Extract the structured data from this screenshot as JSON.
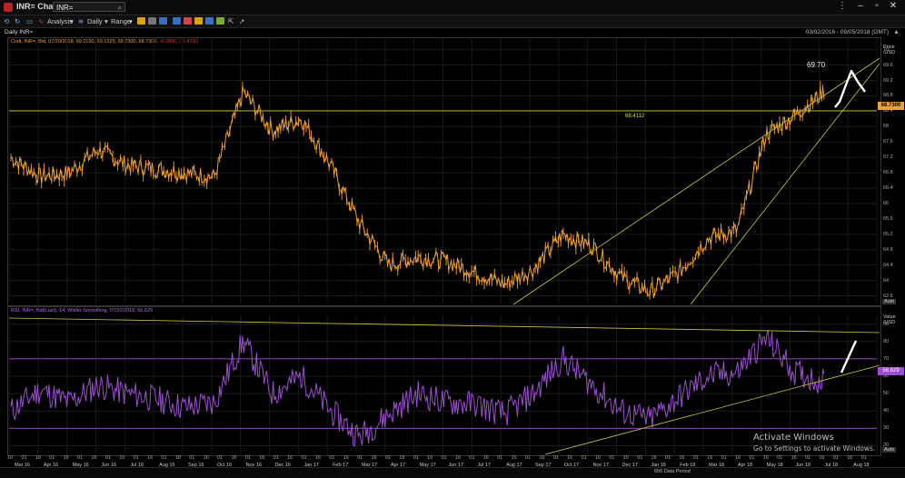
{
  "window": {
    "title": "INR= Chart",
    "symbol": "INR=",
    "minimize": "–",
    "maximize": "▫",
    "close": "✕",
    "more": "⋮"
  },
  "toolbar": {
    "analysis": "Analysis",
    "daily": "Daily",
    "range": "Range"
  },
  "header": {
    "title": "Daily INR=",
    "date_range": "03/02/2016 - 09/05/2018 (GMT)"
  },
  "price_panel": {
    "legend_main": "Cndl, INR=, Bid, 07/20/2018, 69.0150, 69.1225, 68.7300, 68.7300,",
    "legend_change": "-0.2800, (-0.41%)",
    "axis_title": "Price /USD",
    "ticks": [
      "70",
      "69.6",
      "69.2",
      "68.8",
      "68.4",
      "68",
      "67.6",
      "67.2",
      "66.8",
      "66.4",
      "66",
      "65.6",
      "65.2",
      "64.8",
      "64.4",
      "64",
      "63.6"
    ],
    "last_price": "68.7300",
    "hline_label": "68.4112",
    "annotation": "69.70",
    "auto": "Auto"
  },
  "rsi_panel": {
    "legend": "RSI, INR=, Bid(Last), 14, Wilder Smoothing, 07/20/2018, 56.629",
    "axis_title": "Value /USD",
    "ticks": [
      "90",
      "80",
      "70",
      "60",
      "50",
      "40",
      "30",
      "20"
    ],
    "last_value": "56.629",
    "auto": "Auto"
  },
  "xaxis": {
    "days": [
      "16",
      "01",
      "18",
      "01",
      "16",
      "01",
      "16",
      "01",
      "16",
      "01",
      "16",
      "01",
      "18",
      "01",
      "16",
      "01",
      "16",
      "01",
      "16",
      "01",
      "16",
      "01",
      "16",
      "01",
      "16",
      "01",
      "16",
      "01",
      "18",
      "01",
      "16",
      "01",
      "16",
      "01",
      "16",
      "01",
      "16",
      "01",
      "16",
      "01",
      "16",
      "01",
      "16",
      "01",
      "16",
      "01",
      "16",
      "01",
      "16",
      "01",
      "16",
      "01",
      "16",
      "01",
      "16",
      "01",
      "16",
      "01",
      "16",
      "01",
      "16",
      "01"
    ],
    "months": [
      "Mar 16",
      "Apr 16",
      "May 16",
      "Jun 16",
      "Jul 16",
      "Aug 16",
      "Sep 16",
      "Oct 16",
      "Nov 16",
      "Dec 16",
      "Jan 17",
      "Feb 17",
      "Mar 17",
      "Apr 17",
      "May 17",
      "Jun 17",
      "Jul 17",
      "Aug 17",
      "Sep 17",
      "Oct 17",
      "Nov 17",
      "Dec 17",
      "Jan 18",
      "Feb 18",
      "Mar 18",
      "Apr 18",
      "May 18",
      "Jun 18",
      "Jul 18",
      "Aug 18"
    ],
    "data_period": "656 Data Period"
  },
  "watermark": {
    "title": "Activate Windows",
    "subtitle": "Go to Settings to activate Windows."
  },
  "chart_data": [
    {
      "type": "line",
      "title": "Daily INR=",
      "ylabel": "Price /USD",
      "ylim": [
        63.4,
        70.3
      ],
      "x": [
        "Mar 16",
        "Apr 16",
        "May 16",
        "Jun 16",
        "Jul 16",
        "Aug 16",
        "Sep 16",
        "Oct 16",
        "Nov 16",
        "Dec 16",
        "Jan 17",
        "Feb 17",
        "Mar 17",
        "Apr 17",
        "May 17",
        "Jun 17",
        "Jul 17",
        "Aug 17",
        "Sep 17",
        "Oct 17",
        "Nov 17",
        "Dec 17",
        "Jan 18",
        "Feb 18",
        "Mar 18",
        "Apr 18",
        "May 18",
        "Jun 18",
        "Jul 18"
      ],
      "series": [
        {
          "name": "INR=",
          "values": [
            67.2,
            66.7,
            66.8,
            67.4,
            67.0,
            66.9,
            66.8,
            66.7,
            68.9,
            67.9,
            68.2,
            67.0,
            65.5,
            64.4,
            64.6,
            64.5,
            64.2,
            63.9,
            64.3,
            65.2,
            64.9,
            64.1,
            63.7,
            64.2,
            65.1,
            65.3,
            67.8,
            68.3,
            68.9
          ]
        }
      ],
      "hline": 68.4112
    },
    {
      "type": "line",
      "title": "RSI, INR=, Bid(Last), 14, Wilder Smoothing",
      "ylim": [
        15,
        95
      ],
      "x": [
        "Mar 16",
        "Apr 16",
        "May 16",
        "Jun 16",
        "Jul 16",
        "Aug 16",
        "Sep 16",
        "Oct 16",
        "Nov 16",
        "Dec 16",
        "Jan 17",
        "Feb 17",
        "Mar 17",
        "Apr 17",
        "May 17",
        "Jun 17",
        "Jul 17",
        "Aug 17",
        "Sep 17",
        "Oct 17",
        "Nov 17",
        "Dec 17",
        "Jan 18",
        "Feb 18",
        "Mar 18",
        "Apr 18",
        "May 18",
        "Jun 18",
        "Jul 18"
      ],
      "series": [
        {
          "name": "RSI",
          "values": [
            40,
            52,
            45,
            55,
            50,
            47,
            42,
            45,
            80,
            50,
            60,
            40,
            25,
            38,
            50,
            45,
            44,
            38,
            50,
            70,
            55,
            40,
            35,
            48,
            60,
            62,
            82,
            62,
            56.629
          ]
        }
      ],
      "hlines": [
        70,
        30
      ]
    }
  ]
}
